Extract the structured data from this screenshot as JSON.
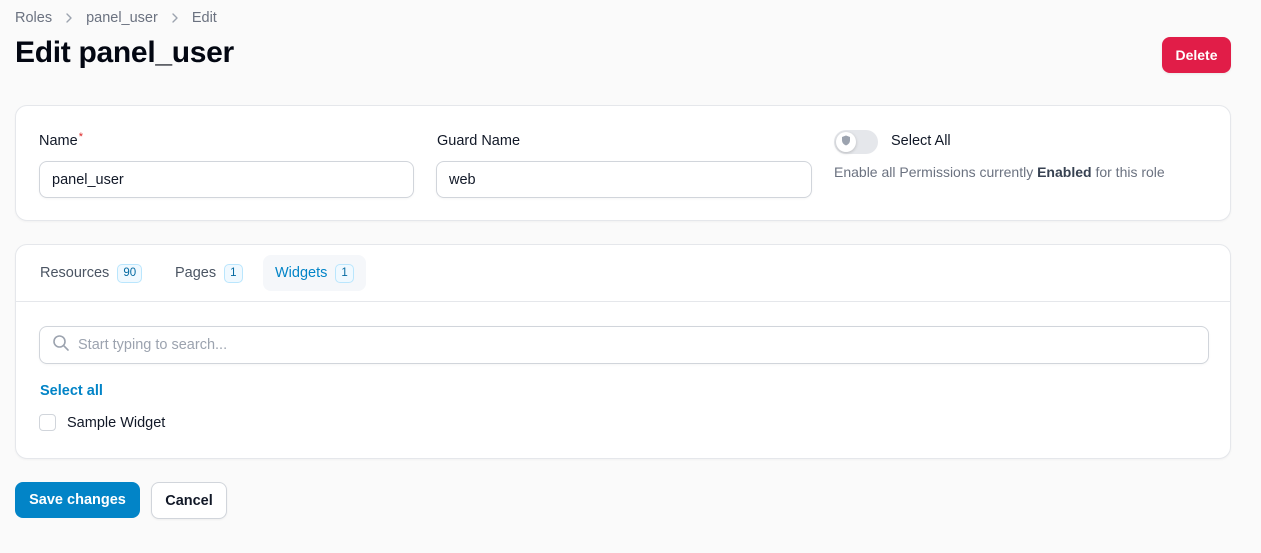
{
  "breadcrumb": {
    "items": [
      "Roles",
      "panel_user",
      "Edit"
    ],
    "separator_icon": "chevron-right-icon"
  },
  "header": {
    "title": "Edit panel_user",
    "delete_label": "Delete"
  },
  "form": {
    "name_label": "Name",
    "name_required_mark": "*",
    "name_value": "panel_user",
    "guard_label": "Guard Name",
    "guard_value": "web",
    "select_all_label": "Select All",
    "select_all_enabled": false,
    "select_all_helper_prefix": "Enable all Permissions currently",
    "select_all_helper_bold": "Enabled",
    "select_all_helper_suffix": "for this role",
    "toggle_icon": "shield-icon"
  },
  "tabs": [
    {
      "label": "Resources",
      "count": "90",
      "active": false
    },
    {
      "label": "Pages",
      "count": "1",
      "active": false
    },
    {
      "label": "Widgets",
      "count": "1",
      "active": true
    }
  ],
  "widgets_panel": {
    "search_placeholder": "Start typing to search...",
    "search_icon": "search-icon",
    "select_all_link": "Select all",
    "items": [
      {
        "label": "Sample Widget",
        "checked": false
      }
    ]
  },
  "footer": {
    "save_label": "Save changes",
    "cancel_label": "Cancel"
  },
  "colors": {
    "primary": "#0284c7",
    "danger": "#e11d48",
    "background": "#fafafa"
  }
}
